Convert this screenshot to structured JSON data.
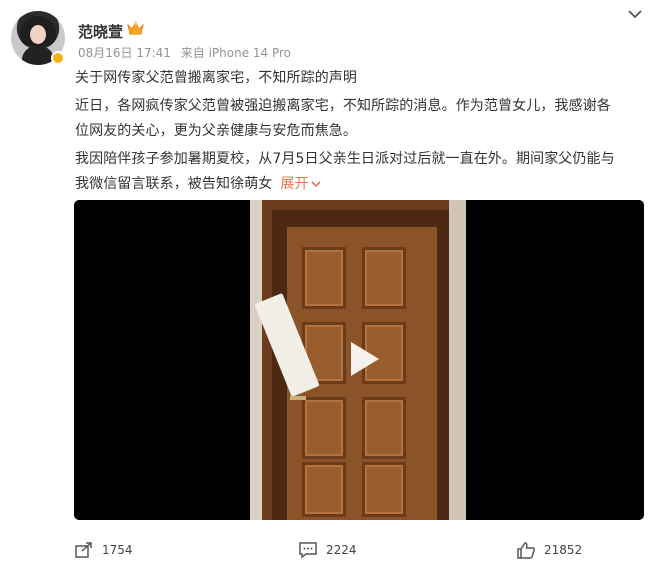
{
  "post": {
    "author": "范晓萱",
    "date": "08月16日 17:41",
    "source": "来自 iPhone 14 Pro",
    "lines": [
      "关于网传家父范曾搬离家宅，不知所踪的声明",
      "近日，各网疯传家父范曾被强迫搬离家宅，不知所踪的消息。作为范曾女儿，我感谢各",
      "位网友的关心，更为父亲健康与安危而焦急。",
      "我因陪伴孩子参加暑期夏校，从7月5日父亲生日派对过后就一直在外。期间家父仍能与",
      "我微信留言联系，被告知徐萌女"
    ],
    "expand_label": "展开"
  },
  "actions": {
    "share_count": "1754",
    "comment_count": "2224",
    "like_count": "21852"
  },
  "icons": {
    "crown": "crown-icon",
    "menu": "chevron-down-icon",
    "share": "share-icon",
    "comment": "comment-icon",
    "like": "thumbs-up-icon",
    "play": "play-icon"
  },
  "colors": {
    "accent": "#eb7350",
    "meta": "#939393",
    "badge": "#f5b20f"
  }
}
